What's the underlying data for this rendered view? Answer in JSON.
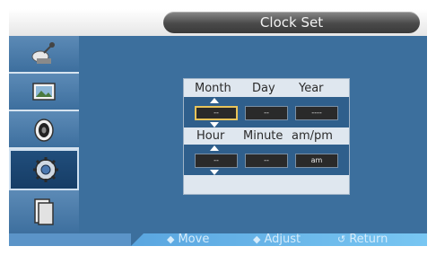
{
  "title": "Clock Set",
  "sidebar": {
    "items": [
      {
        "icon": "satellite-dish-icon"
      },
      {
        "icon": "picture-frame-icon"
      },
      {
        "icon": "speaker-icon"
      },
      {
        "icon": "gear-icon",
        "active": true
      },
      {
        "icon": "document-icon"
      }
    ]
  },
  "date": {
    "headers": [
      "Month",
      "Day",
      "Year"
    ],
    "values": [
      "--",
      "--",
      "----"
    ]
  },
  "time": {
    "headers": [
      "Hour",
      "Minute",
      "am/pm"
    ],
    "values": [
      "--",
      "--",
      "am"
    ]
  },
  "footer": {
    "move": "Move",
    "adjust": "Adjust",
    "return": "Return"
  },
  "colors": {
    "background": "#3c6f9d",
    "focus": "#e8c45a",
    "footer_text": "#d6ecfb"
  }
}
